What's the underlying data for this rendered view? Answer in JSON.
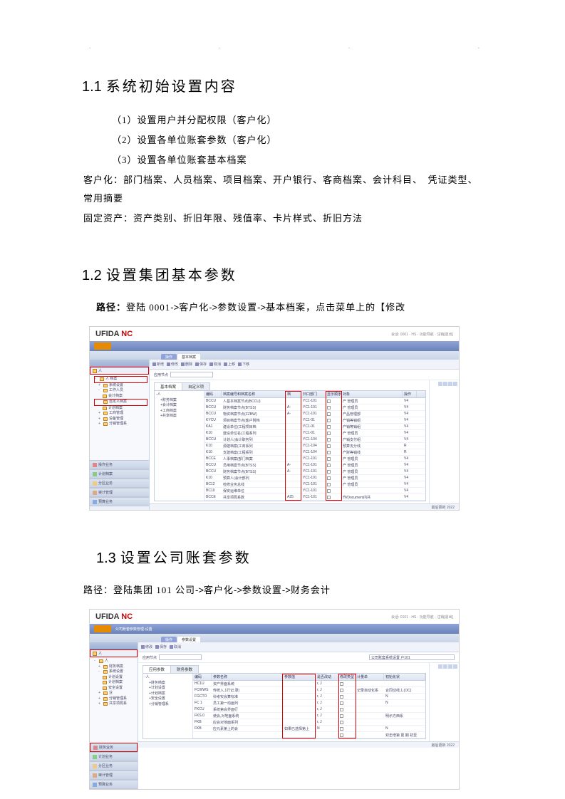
{
  "dots": [
    ".",
    ".",
    ".",
    "."
  ],
  "section1": {
    "heading_num": "1.1",
    "heading_text": "系统初始设置内容",
    "items": [
      "（1）设置用户并分配权限（客户化）",
      "（2）设置各单位账套参数（客户化）",
      "（3）设置各单位账套基本档案"
    ],
    "line1": "客户化：部门档案、人员档案、项目档案、开户银行、客商档案、会计科目、　凭证类型、常用摘要",
    "line2": "固定资产：资产类别、折旧年限、残值率、卡片样式、折旧方法"
  },
  "section2": {
    "heading_num": "1.2",
    "heading_text": "设置集团基本参数",
    "path_label": "路径：",
    "path_text_a": "登陆 0001",
    "path_text_b": "客户化",
    "path_text_c": "参数设置",
    "path_text_d": "基本档案，点击菜单上的【修改"
  },
  "section3": {
    "heading_num": "1.3",
    "heading_text": "设置公司账套参数",
    "path_label": "路径：",
    "path_text_a": "登陆集团 101 公司",
    "path_text_b": "客户化",
    "path_text_c": "参数设置",
    "path_text_d": "财务会计"
  },
  "screenshot1": {
    "logo_a": "UFIDA",
    "logo_b": "NC",
    "top_right": "会话: 0001 · HS · 功能导航 · 注销[退出]",
    "tabs": [
      "操作",
      "基本档案"
    ],
    "toolbar": [
      "新增",
      "修改",
      "删除",
      "保存",
      "取消",
      "上移",
      "下移"
    ],
    "tabs2": [
      "基本档案",
      "自定义项"
    ],
    "input_label": "应用节点",
    "headers": [
      "编码",
      "档案编号和档案名称",
      "档",
      "归口部门",
      "显示顺序",
      "对象",
      "操作"
    ],
    "rows": [
      [
        "BCCU",
        "人基本档案节点(BCCU)",
        "",
        "YC1-101",
        "",
        "产 管理员",
        "V4"
      ],
      [
        "BCCU",
        "财务档案节点(BTSS)",
        "A-",
        "YC1-101",
        "",
        "产 管理员",
        "V4"
      ],
      [
        "BCCU",
        "物资档案节点(ZZBW)",
        "A-",
        "YC1-101",
        "",
        "产品管理部",
        "V4"
      ],
      [
        "KYCU",
        "项目档案节点(客户附档",
        "",
        "YC1-01",
        "",
        "产销等销组",
        "V4"
      ],
      [
        "KA1",
        "建设单位(工程项目档",
        "",
        "YC1-01",
        "",
        "产销等销组",
        "V4"
      ],
      [
        "K10",
        "建设单位名(工程系列",
        "",
        "YC1-01",
        "",
        "产 管理员",
        "V4"
      ],
      [
        "BCCU",
        "计划人(会计职务列",
        "",
        "YC1-104",
        "",
        "产销支付组",
        "V4"
      ],
      [
        "K10",
        "源建档案(工商系列",
        "",
        "YC1-104",
        "",
        "预算支分线",
        "R"
      ],
      [
        "K10",
        "支建档案(工程系列",
        "",
        "YC1-104",
        "",
        "产财等销线",
        "R"
      ],
      [
        "BCCE",
        "人事档案(部门档案",
        "",
        "YC1-101",
        "",
        "产 管理员",
        "V4"
      ],
      [
        "BCCU",
        "员用档案节点(BTSS)",
        "A-",
        "YC1-101",
        "",
        "产 管理员",
        "V4"
      ],
      [
        "BCCU",
        "财务档案节点(BTSS)",
        "A-",
        "YC1-101",
        "",
        "产 管理员",
        "V4"
      ],
      [
        "K10",
        "预算人(会计部列",
        "",
        "YC1-101",
        "",
        "产 管理员",
        "V4"
      ],
      [
        "BC12",
        "检修业务总线",
        "",
        "YC1-101",
        "",
        "产 管理员",
        "V4"
      ],
      [
        "BC10",
        "保安运维单位",
        "",
        "YC1-101",
        "",
        "",
        "V4"
      ],
      [
        "BCCE",
        "共享项局系数",
        "A25",
        "YC1-101",
        "",
        "作/Document内共",
        "V4"
      ]
    ],
    "tree_main": [
      "人 档案",
      "系统设置",
      "工作人员",
      "会计档案",
      "自定义档案",
      "计划档案",
      "工商管理",
      "设备管理",
      "分销管理系"
    ],
    "sidebar_sections": [
      "操作业务",
      "计划档案",
      "分区业务",
      "审计管理",
      "预算业务"
    ],
    "tree_nav": [
      "人",
      "财务档案",
      "会计档案",
      "工商档案",
      "共享档案"
    ],
    "status": "最后更新 2022"
  },
  "screenshot2": {
    "logo_a": "UFIDA",
    "logo_b": "NC",
    "top_right": "会话: 0101 · HS · 功能导航 · 注销[退出]",
    "navbar": "公司账套参数管理-设置",
    "tabs": [
      "操作",
      "参数设置"
    ],
    "toolbar": [
      "修改",
      "保存",
      "取消"
    ],
    "input_label": "应用节点",
    "input_right": "公司账套系统设置 户101",
    "tabs2": [
      "应用参数",
      "财务参数"
    ],
    "tree_nav": [
      "人",
      "财务档案",
      "系统设置",
      "计划设置",
      "计划档案",
      "安全设置",
      "业",
      "分销管理系",
      "共享项局系"
    ],
    "sidebar_sections": [
      "财务业务",
      "计划业务",
      "分区业务",
      "审计管理",
      "预算业务"
    ],
    "headers": [
      "编码",
      "参数名称",
      "参数值",
      "是否改动",
      "修改类型",
      "计量单",
      "初始化状"
    ],
    "rows": [
      [
        "HC1U",
        "资产界面系统",
        "",
        "r, J",
        "",
        "",
        ""
      ],
      [
        "FCWWS",
        "传统入,1行记,录)",
        "",
        "r, J",
        "",
        "记录自动化系",
        "合同切线,1,(OC)"
      ],
      [
        "FGCTO",
        "科考实会算标准",
        "",
        "r, J",
        "",
        "",
        "N"
      ],
      [
        "FC 1",
        "员工第一动画列",
        "",
        "r, J",
        "",
        "",
        "N"
      ],
      [
        "FKCU",
        "系统第会界面行",
        "",
        "r, J",
        "",
        "",
        ""
      ],
      [
        "FKS.0",
        "使会,对地面系统",
        "",
        "r, J",
        "",
        "",
        "明示方西系"
      ],
      [
        "FKB",
        "应会对地面系列",
        "",
        "r, J",
        "",
        "",
        ""
      ],
      [
        "FKB",
        "应元素第上的会",
        "如果已选择第上",
        "N",
        "",
        "",
        "N"
      ],
      [
        "",
        "",
        "",
        "",
        "",
        "",
        "双击增第 更 期 初至"
      ]
    ],
    "status": "最后更新 2022"
  }
}
